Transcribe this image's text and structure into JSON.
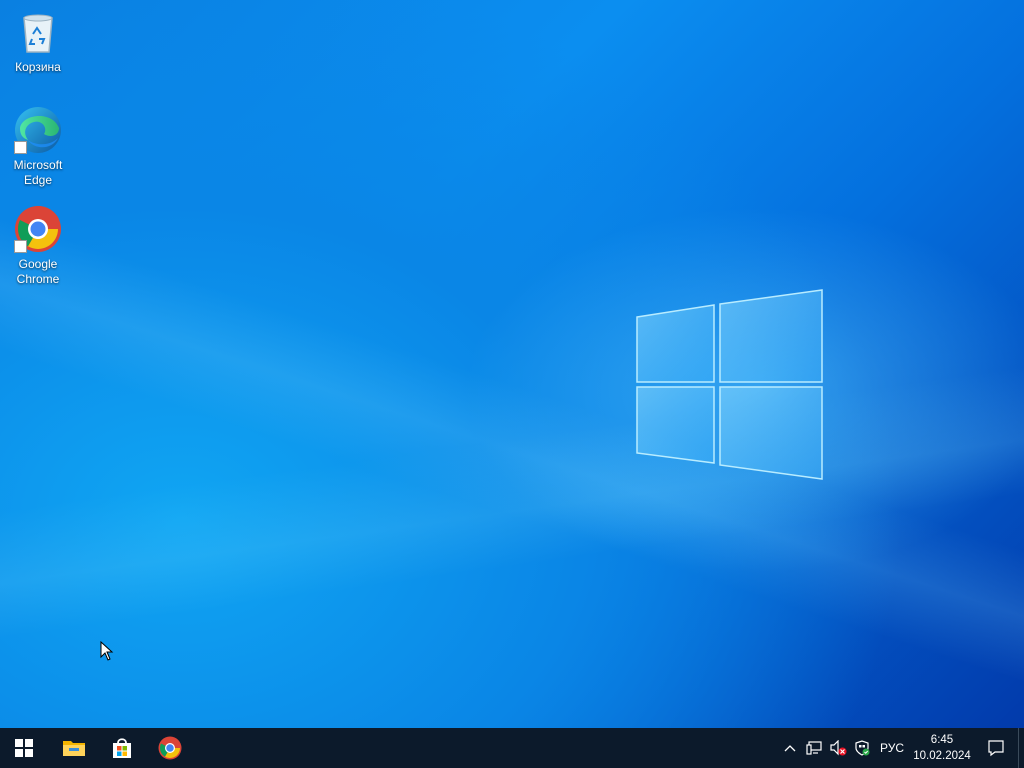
{
  "desktop": {
    "icons": [
      {
        "label": "Корзина",
        "icon": "recycle-bin-icon"
      },
      {
        "label": "Microsoft Edge",
        "icon": "microsoft-edge-icon"
      },
      {
        "label": "Google Chrome",
        "icon": "google-chrome-icon"
      }
    ]
  },
  "taskbar": {
    "pinned": [
      {
        "icon": "windows-start-icon"
      },
      {
        "icon": "file-explorer-icon"
      },
      {
        "icon": "microsoft-store-icon"
      },
      {
        "icon": "google-chrome-icon"
      }
    ],
    "tray": {
      "icons": [
        "chevron-up-icon",
        "network-icon",
        "volume-muted-icon",
        "windows-security-icon"
      ],
      "language": "РУС",
      "time": "6:45",
      "date": "10.02.2024"
    }
  },
  "colors": {
    "taskbar": "#0c1a2b",
    "wallpaper_accent": "#0a86e6"
  }
}
